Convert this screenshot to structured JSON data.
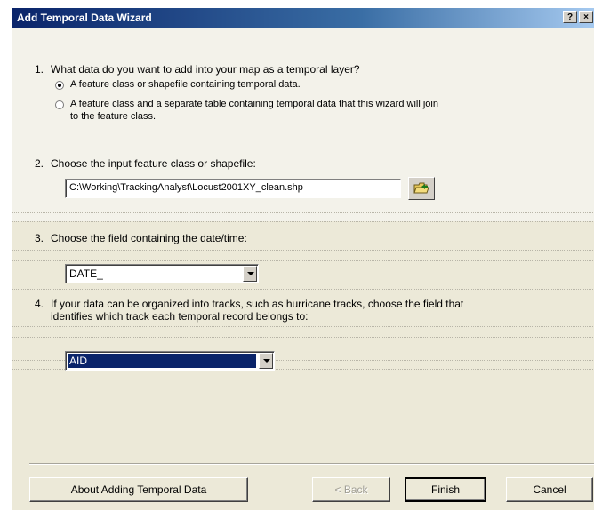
{
  "window": {
    "title": "Add Temporal Data Wizard",
    "help_button": "?",
    "close_button": "×"
  },
  "steps": {
    "q1": {
      "number": "1.",
      "text": "What data do you want to add into your map as a temporal layer?",
      "options": [
        {
          "label": "A feature class or shapefile containing temporal data.",
          "checked": true
        },
        {
          "label_line1": "A feature class and a separate table containing temporal data that this wizard will join",
          "label_line2": "to the feature class.",
          "checked": false
        }
      ]
    },
    "q2": {
      "number": "2.",
      "text": "Choose the input feature class or shapefile:",
      "input_value": "C:\\Working\\TrackingAnalyst\\Locust2001XY_clean.shp"
    },
    "q3": {
      "number": "3.",
      "text": "Choose the field containing the date/time:",
      "selected_value": "DATE_"
    },
    "q4": {
      "number": "4.",
      "text_line1": "If your data can be organized into tracks, such as hurricane tracks, choose the field that",
      "text_line2": "identifies which track each temporal record belongs to:",
      "selected_value": "AID"
    }
  },
  "buttons": {
    "about": "About Adding Temporal Data",
    "back": "< Back",
    "finish": "Finish",
    "cancel": "Cancel"
  }
}
